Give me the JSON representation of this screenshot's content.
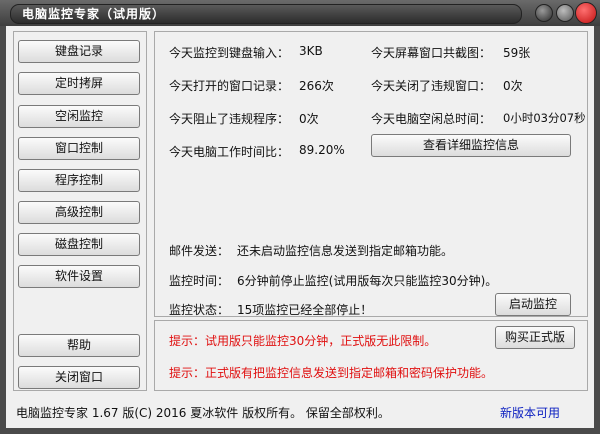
{
  "window": {
    "title": "电脑监控专家（试用版）"
  },
  "sidebar": {
    "items": [
      {
        "label": "键盘记录"
      },
      {
        "label": "定时拷屏"
      },
      {
        "label": "空闲监控"
      },
      {
        "label": "窗口控制"
      },
      {
        "label": "程序控制"
      },
      {
        "label": "高级控制"
      },
      {
        "label": "磁盘控制"
      },
      {
        "label": "软件设置"
      }
    ],
    "help_label": "帮助",
    "close_label": "关闭窗口"
  },
  "stats": {
    "keyboard_input_label": "今天监控到键盘输入：",
    "keyboard_input_value": "3KB",
    "screenshots_label": "今天屏幕窗口共截图：",
    "screenshots_value": "59张",
    "windows_opened_label": "今天打开的窗口记录：",
    "windows_opened_value": "266次",
    "violating_windows_label": "今天关闭了违规窗口：",
    "violating_windows_value": "0次",
    "blocked_programs_label": "今天阻止了违规程序：",
    "blocked_programs_value": "0次",
    "idle_time_label": "今天电脑空闲总时间：",
    "idle_time_value": "0小时03分07秒",
    "work_ratio_label": "今天电脑工作时间比：",
    "work_ratio_value": "89.20%",
    "details_button": "查看详细监控信息"
  },
  "status": {
    "email_label": "邮件发送：",
    "email_value": "还未启动监控信息发送到指定邮箱功能。",
    "monitor_time_label": "监控时间：",
    "monitor_time_value": "6分钟前停止监控(试用版每次只能监控30分钟)。",
    "monitor_state_label": "监控状态：",
    "monitor_state_value": "15项监控已经全部停止！",
    "start_button": "启动监控"
  },
  "notices": {
    "notice1": "提示：试用版只能监控30分钟，正式版无此限制。",
    "notice2": "提示：正式版有把监控信息发送到指定邮箱和密码保护功能。",
    "buy_button": "购买正式版"
  },
  "footer": {
    "copyright": "电脑监控专家  1.67  版(C)  2016 夏冰软件 版权所有。 保留全部权利。",
    "new_version_link": "新版本可用"
  },
  "colors": {
    "notice": "#e01010",
    "link": "#0a1ec0",
    "close_button": "#d01818"
  }
}
